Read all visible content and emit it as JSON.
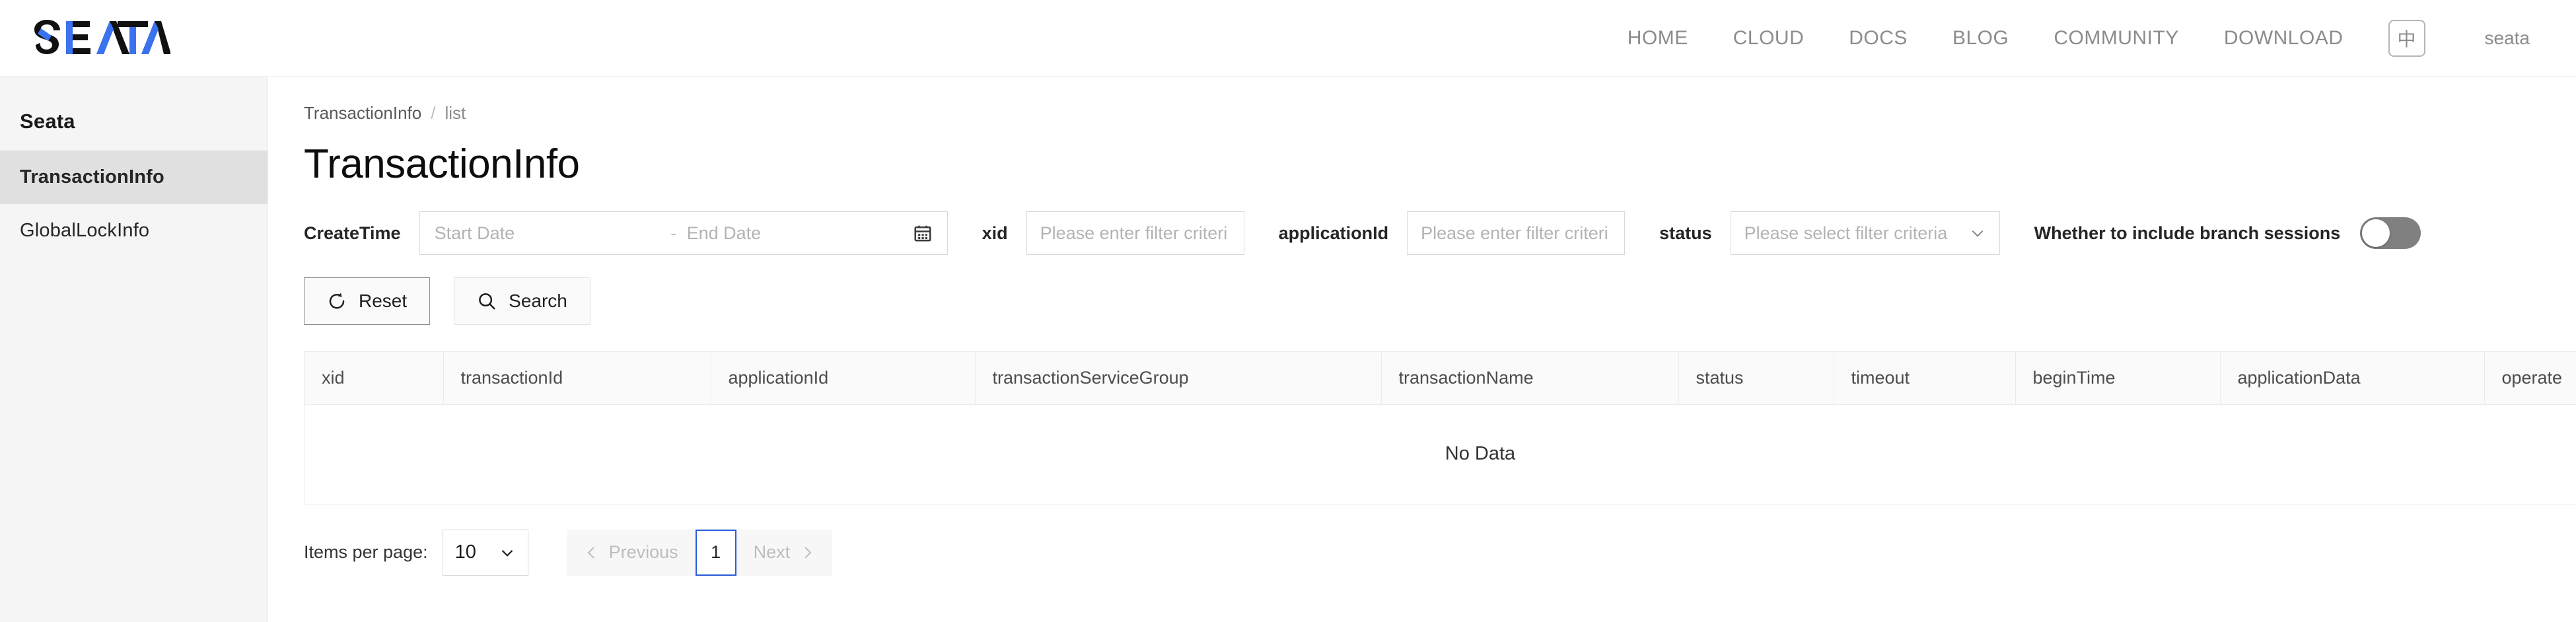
{
  "topnav": {
    "logo_text": "SEATA",
    "links": [
      {
        "label": "HOME"
      },
      {
        "label": "CLOUD"
      },
      {
        "label": "DOCS"
      },
      {
        "label": "BLOG"
      },
      {
        "label": "COMMUNITY"
      },
      {
        "label": "DOWNLOAD"
      }
    ],
    "lang_label": "中",
    "user": "seata"
  },
  "sidebar": {
    "brand": "Seata",
    "items": [
      {
        "label": "TransactionInfo",
        "active": true
      },
      {
        "label": "GlobalLockInfo",
        "active": false
      }
    ]
  },
  "breadcrumb": {
    "root": "TransactionInfo",
    "separator": "/",
    "current": "list"
  },
  "page_title": "TransactionInfo",
  "filters": {
    "create_time_label": "CreateTime",
    "start_date_placeholder": "Start Date",
    "range_dash": "-",
    "end_date_placeholder": "End Date",
    "xid_label": "xid",
    "xid_placeholder": "Please enter filter criteri",
    "application_id_label": "applicationId",
    "application_id_placeholder": "Please enter filter criteri",
    "status_label": "status",
    "status_placeholder": "Please select filter criteria",
    "branch_sessions_label": "Whether to include branch sessions",
    "branch_sessions_on": false
  },
  "buttons": {
    "reset": "Reset",
    "search": "Search"
  },
  "table": {
    "columns": [
      "xid",
      "transactionId",
      "applicationId",
      "transactionServiceGroup",
      "transactionName",
      "status",
      "timeout",
      "beginTime",
      "applicationData",
      "operate"
    ],
    "rows": [],
    "empty_text": "No Data"
  },
  "pagination": {
    "items_per_page_label": "Items per page:",
    "items_per_page_value": "10",
    "previous_label": "Previous",
    "current_page": "1",
    "next_label": "Next"
  },
  "colors": {
    "accent_blue": "#2a5bd7",
    "logo_blue": "#3b72ef",
    "sidebar_bg": "#f5f5f5",
    "sidebar_active": "#e0e0e0",
    "nav_text": "#8c8c8c",
    "toggle_off": "#808080"
  }
}
